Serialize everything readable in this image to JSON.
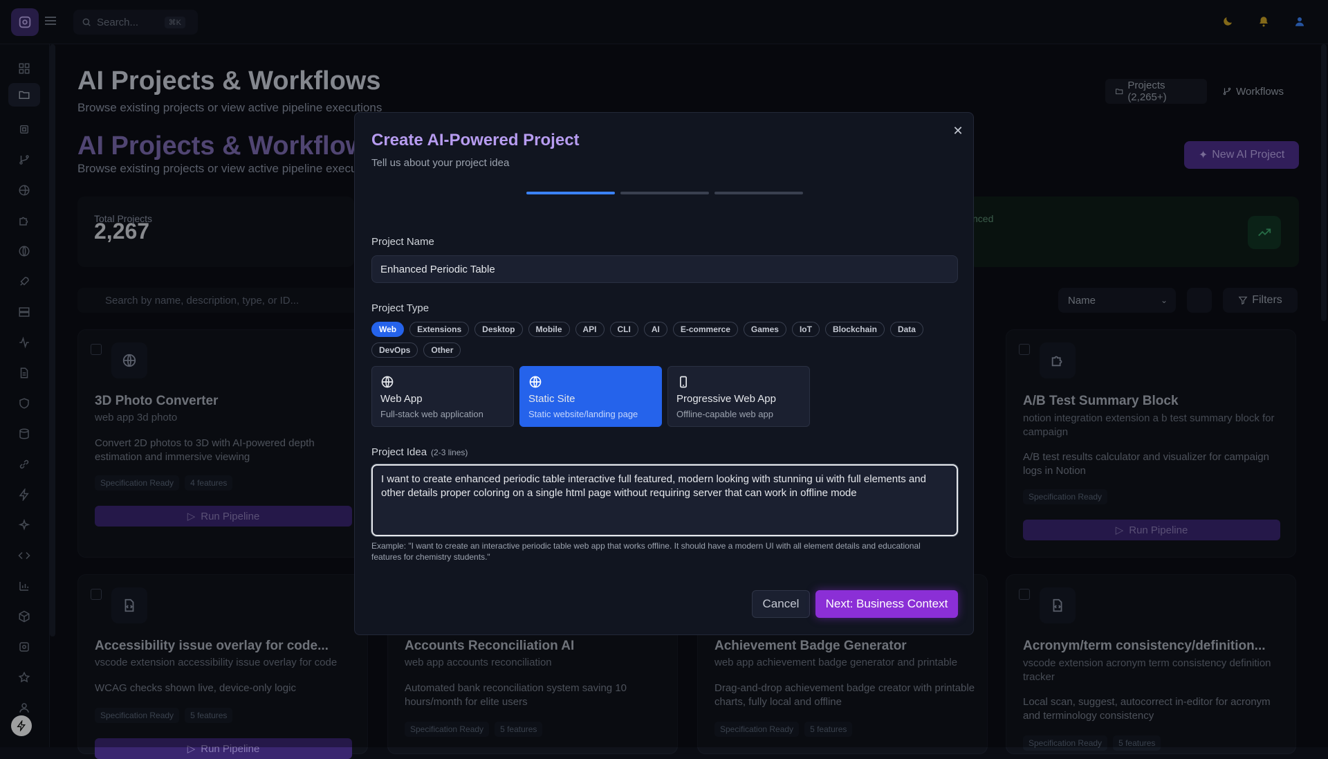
{
  "topbar": {
    "search_placeholder": "Search...",
    "search_shortcut": "⌘K"
  },
  "page": {
    "title": "AI Projects & Workflows",
    "subtitle": "Browse existing projects or view active pipeline executions",
    "segments": {
      "projects": "Projects (2,265+)",
      "workflows": "Workflows"
    },
    "new_project": "New AI Project",
    "stat": {
      "label": "Total Projects",
      "value": "2,267"
    },
    "stat_right_label": "nced",
    "search_placeholder": "Search by name, description, type, or ID...",
    "sort_value": "Name",
    "filters": "Filters"
  },
  "cards": [
    {
      "title": "3D Photo Converter",
      "sub": "web app 3d photo",
      "desc": "Convert 2D photos to 3D with AI-powered depth estimation and immersive viewing",
      "status": "Specification Ready",
      "features": "4 features",
      "run": "Run Pipeline"
    },
    {
      "title": "A/B Test Summary Block",
      "sub": "notion integration extension a b test summary block for campaign",
      "desc": "A/B test results calculator and visualizer for campaign logs in Notion",
      "status": "Specification Ready",
      "run": "Run Pipeline"
    },
    {
      "title": "Accessibility issue overlay for code...",
      "sub": "vscode extension accessibility issue overlay for code",
      "desc": "WCAG checks shown live, device-only logic",
      "status": "Specification Ready",
      "features": "5 features",
      "run": "Run Pipeline"
    },
    {
      "title": "Accounts Reconciliation AI",
      "sub": "web app accounts reconciliation",
      "desc": "Automated bank reconciliation system saving 10 hours/month for elite users",
      "status": "Specification Ready",
      "features": "5 features"
    },
    {
      "title": "Achievement Badge Generator",
      "sub": "web app achievement badge generator and printable",
      "desc": "Drag-and-drop achievement badge creator with printable charts, fully local and offline",
      "status": "Specification Ready",
      "features": "5 features"
    },
    {
      "title": "Acronym/term consistency/definition...",
      "sub": "vscode extension acronym term consistency definition tracker",
      "desc": "Local scan, suggest, autocorrect in-editor for acronym and terminology consistency",
      "status": "Specification Ready",
      "features": "5 features"
    }
  ],
  "modal": {
    "title": "Create AI-Powered Project",
    "subtitle": "Tell us about your project idea",
    "name_label": "Project Name",
    "name_value": "Enhanced Periodic Table",
    "type_label": "Project Type",
    "chips": [
      "Web",
      "Extensions",
      "Desktop",
      "Mobile",
      "API",
      "CLI",
      "AI",
      "E-commerce",
      "Games",
      "IoT",
      "Blockchain",
      "Data",
      "DevOps",
      "Other"
    ],
    "selected_chip": "Web",
    "subtypes": [
      {
        "name": "Web App",
        "desc": "Full-stack web application",
        "icon": "globe-icon"
      },
      {
        "name": "Static Site",
        "desc": "Static website/landing page",
        "icon": "globe-icon"
      },
      {
        "name": "Progressive Web App",
        "desc": "Offline-capable web app",
        "icon": "smartphone-icon"
      }
    ],
    "selected_subtype": "Static Site",
    "idea_label": "Project Idea",
    "idea_hint": "(2-3 lines)",
    "idea_value": "I want to create enhanced periodic table interactive full featured, modern looking with stunning ui with full elements and other details proper coloring on a single html page without requiring server that can work in offline mode",
    "example": "Example: \"I want to create an interactive periodic table web app that works offline. It should have a modern UI with all element details and educational features for chemistry students.\"",
    "cancel": "Cancel",
    "next": "Next: Business Context"
  },
  "colors": {
    "accent": "#8b2fd6",
    "selected": "#2563eb",
    "title": "#b79cf0"
  }
}
